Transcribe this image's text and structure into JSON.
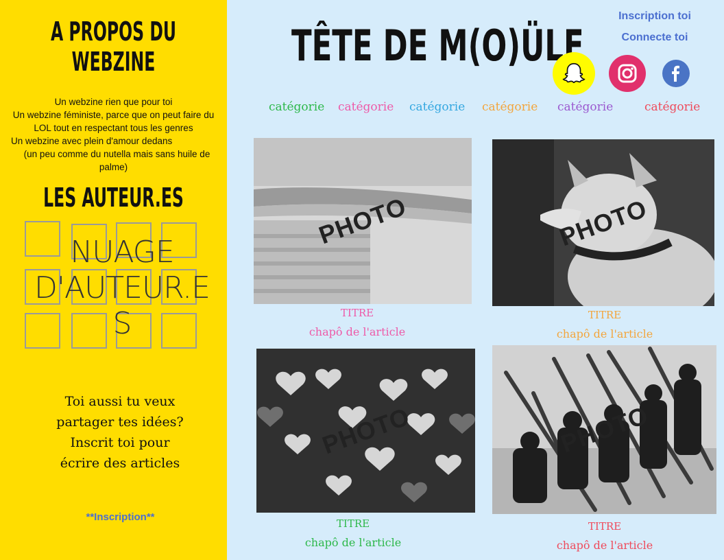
{
  "sidebar": {
    "about_title_line1": "A PROPOS DU",
    "about_title_line2": "WEBZINE",
    "about_lines": [
      "Un webzine rien que pour toi",
      "Un webzine féministe, parce que on peut faire du",
      "LOL tout en respectant tous les genres",
      "Un webzine avec plein d'amour dedans",
      "(un peu comme du nutella mais sans huile de",
      "palme)"
    ],
    "authors_title": "LES AUTEUR.ES",
    "cloud_lines": [
      "NUAGE",
      "D'AUTEUR.E",
      "S"
    ],
    "invite_lines": [
      "Toi aussi tu veux",
      "partager tes idées?",
      "Inscrit toi pour",
      "écrire des articles"
    ],
    "signup_link": "**Inscription**"
  },
  "header": {
    "site_title": "TÊTE DE M(O)ÜLE",
    "signup": "Inscription toi",
    "login": "Connecte toi",
    "social": [
      {
        "icon": "snapchat-icon",
        "color": "#fffc00"
      },
      {
        "icon": "instagram-icon",
        "color": "#e1306c"
      },
      {
        "icon": "facebook-icon",
        "color": "#4a74c5"
      }
    ]
  },
  "categories": [
    {
      "label": "catégorie",
      "color": "#2db84a"
    },
    {
      "label": "catégorie",
      "color": "#ee5aa8"
    },
    {
      "label": "catégorie",
      "color": "#33a7e0"
    },
    {
      "label": "catégorie",
      "color": "#f3a53c"
    },
    {
      "label": "catégorie",
      "color": "#9b59d0"
    },
    {
      "label": "catégorie",
      "color": "#ef4a5b"
    }
  ],
  "articles": [
    {
      "watermark": "PHOTO",
      "title": "TITRE",
      "chapo": "chapô de l'article",
      "color": "#ee5aa8"
    },
    {
      "watermark": "PHOTO",
      "title": "TITRE",
      "chapo": "chapô de l'article",
      "color": "#f3a53c"
    },
    {
      "watermark": "PHOTO",
      "title": "TITRE",
      "chapo": "chapô de l'article",
      "color": "#2db84a"
    },
    {
      "watermark": "PHOTO",
      "title": "TITRE",
      "chapo": "chapô de l'article",
      "color": "#ef4a5b"
    }
  ]
}
